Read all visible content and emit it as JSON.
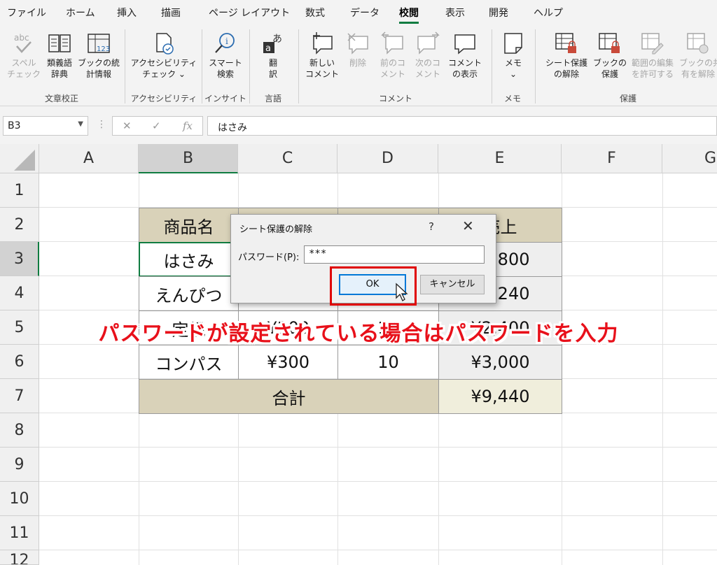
{
  "ribbon_tabs": [
    "ファイル",
    "ホーム",
    "挿入",
    "描画",
    "ページ レイアウト",
    "数式",
    "データ",
    "校閲",
    "表示",
    "開発",
    "ヘルプ"
  ],
  "active_tab": "校閲",
  "ribbon": {
    "spell1": "スペル",
    "spell2": "チェック",
    "thesaurus1": "類義語",
    "thesaurus2": "辞典",
    "stats1": "ブックの統",
    "stats2": "計情報",
    "acc1": "アクセシビリティ",
    "acc2": "チェック ⌄",
    "smart1": "スマート",
    "smart2": "検索",
    "trans1": "翻",
    "trans2": "訳",
    "newc1": "新しい",
    "newc2": "コメント",
    "del1": "削除",
    "prev1": "前のコ",
    "prev2": "メント",
    "next1": "次のコ",
    "next2": "メント",
    "showc1": "コメント",
    "showc2": "の表示",
    "memo1": "メモ",
    "memo2": "⌄",
    "unprot1": "シート保護",
    "unprot2": "の解除",
    "protbook1": "ブックの",
    "protbook2": "保護",
    "range1": "範囲の編集",
    "range2": "を許可する",
    "share1": "ブックの共",
    "share2": "有を解除",
    "groups": {
      "proofing": "文章校正",
      "accessibility": "アクセシビリティ",
      "insights": "インサイト",
      "language": "言語",
      "comments": "コメント",
      "notes": "メモ",
      "protect": "保護"
    }
  },
  "formula_bar": {
    "name_box": "B3",
    "dots": "⋮",
    "cancel": "✕",
    "enter": "✓",
    "fx": "fx",
    "formula": "はさみ"
  },
  "columns": [
    "A",
    "B",
    "C",
    "D",
    "E",
    "F",
    "G"
  ],
  "rows": [
    "1",
    "2",
    "3",
    "4",
    "5",
    "6",
    "7",
    "8",
    "9",
    "10",
    "11",
    "12"
  ],
  "table": {
    "b2": "商品名",
    "e2": "売上",
    "b3": "はさみ",
    "e3": "¥1,800",
    "b4": "えんぴつ",
    "e4": "¥2,240",
    "b5": "定規",
    "c5": "¥200",
    "d5": "12",
    "e5": "¥2,400",
    "b6": "コンパス",
    "c6": "¥300",
    "d6": "10",
    "e6": "¥3,000",
    "b7": "合計",
    "e7": "¥9,440"
  },
  "dialog": {
    "title": "シート保護の解除",
    "help": "?",
    "close": "✕",
    "label": "パスワード(P):",
    "password": "***",
    "ok": "OK",
    "cancel": "キャンセル"
  },
  "callout": "パスワードが設定されている場合はパスワードを入力",
  "colors": {
    "accent": "#107c41",
    "header_fill": "#d9d2b9",
    "callout": "#e8101a",
    "highlight": "#e00000",
    "focus": "#0078d7"
  }
}
